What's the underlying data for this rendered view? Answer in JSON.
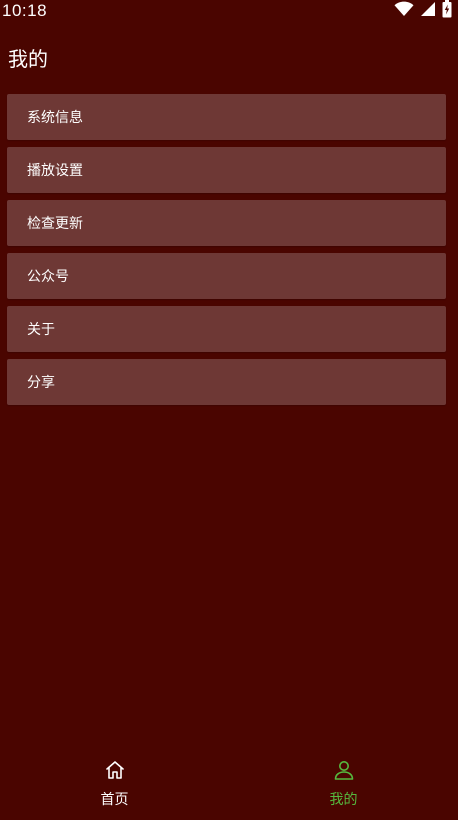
{
  "status_bar": {
    "time": "10:18",
    "icons": [
      "wifi-icon",
      "signal-icon",
      "battery-icon"
    ]
  },
  "header": {
    "title": "我的"
  },
  "menu": {
    "items": [
      {
        "label": "系统信息"
      },
      {
        "label": "播放设置"
      },
      {
        "label": "检查更新"
      },
      {
        "label": "公众号"
      },
      {
        "label": "关于"
      },
      {
        "label": "分享"
      }
    ]
  },
  "bottom_nav": {
    "items": [
      {
        "label": "首页",
        "icon": "home-icon",
        "active": false
      },
      {
        "label": "我的",
        "icon": "user-icon",
        "active": true
      }
    ]
  },
  "colors": {
    "background": "#4a0500",
    "menu_item": "#6e3835",
    "active_tab": "#56b93e",
    "inactive_tab": "#ffffff"
  }
}
